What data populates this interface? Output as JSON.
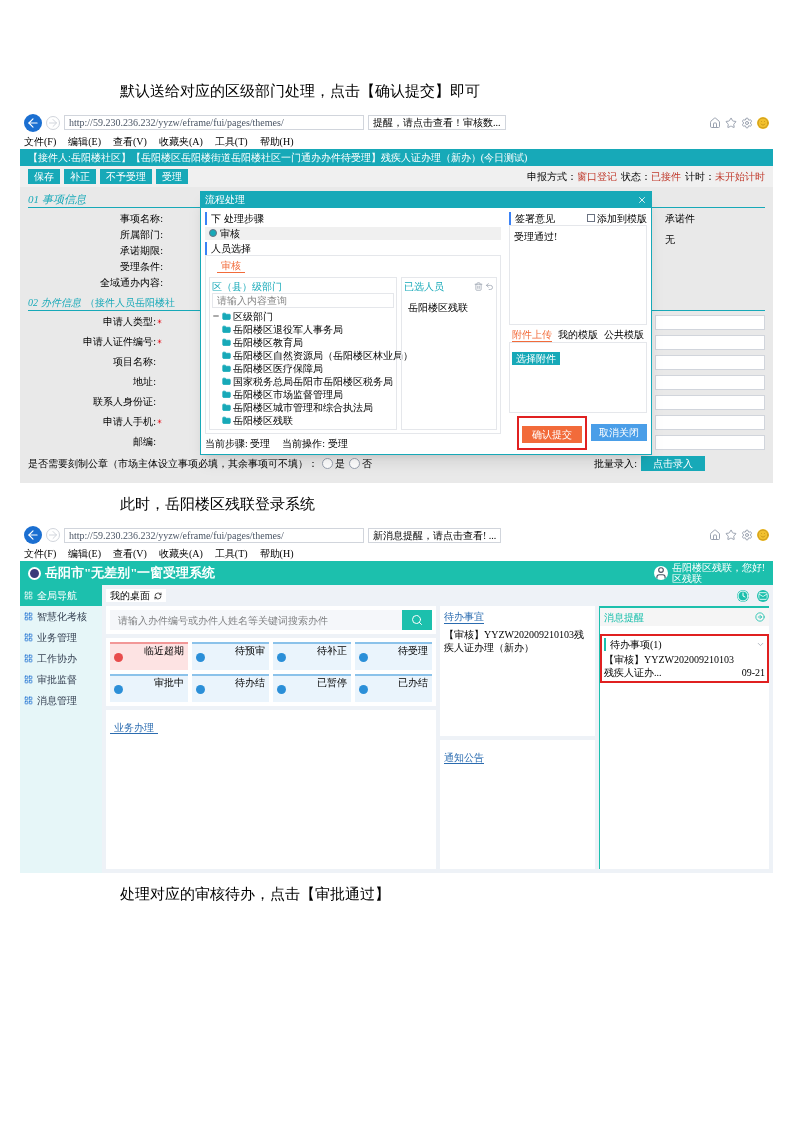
{
  "captions": [
    "默认送给对应的区级部门处理，点击【确认提交】即可",
    "此时，岳阳楼区残联登录系统",
    "处理对应的审核待办，点击【审批通过】"
  ],
  "shot1": {
    "browser": {
      "url": "http://59.230.236.232/yyzw/eframe/fui/pages/themes/",
      "tab": "提醒，请点击查看！审核数...",
      "menu": [
        "文件(F)",
        "编辑(E)",
        "查看(V)",
        "收藏夹(A)",
        "工具(T)",
        "帮助(H)"
      ]
    },
    "header": "【接件人:岳阳楼社区】【岳阳楼区岳阳楼街道岳阳楼社区一门通办办件待受理】残疾人证办理（新办）(今日测试)",
    "toolbar": [
      "保存",
      "补正",
      "不予受理",
      "受理"
    ],
    "status": [
      {
        "label": "申报方式：",
        "value": "窗口登记"
      },
      {
        "label": "状态：",
        "value": "已接件"
      },
      {
        "label": "计时：",
        "value": "未开始计时"
      }
    ],
    "section1": {
      "title": "01 事项信息",
      "fields": [
        "事项名称:",
        "所属部门:",
        "承诺期限:",
        "受理条件:",
        "全域通办内容:"
      ],
      "right_values": [
        "承诺件",
        "无"
      ]
    },
    "section2": {
      "title": "02 办件信息",
      "subtitle": "（接件人员岳阳楼社",
      "fields": [
        {
          "label": "申请人类型:",
          "required": true
        },
        {
          "label": "申请人证件编号:",
          "required": true
        },
        {
          "label": "项目名称:",
          "required": false
        },
        {
          "label": "地址:",
          "required": false
        },
        {
          "label": "联系人身份证:",
          "required": false
        },
        {
          "label": "申请人手机:",
          "required": true
        },
        {
          "label": "邮编:",
          "required": false
        }
      ],
      "seal_question": "是否需要刻制公章（市场主体设立事项必填，其余事项可不填）：",
      "seal_options": [
        {
          "label": "是",
          "selected": false
        },
        {
          "label": "否",
          "selected": false
        }
      ],
      "batch_label": "批量录入:",
      "batch_button": "点击录入"
    },
    "dialog": {
      "title": "流程处理",
      "step_title": "下 处理步骤",
      "step_option": {
        "label": "审核",
        "selected": true
      },
      "person_title": "人员选择",
      "tab": "审核",
      "dept_tab": "区（县）级部门",
      "search_placeholder": "请输入内容查询",
      "tree": {
        "label": "区级部门",
        "expanded": true,
        "children": [
          {
            "label": "岳阳楼区退役军人事务局"
          },
          {
            "label": "岳阳楼区教育局"
          },
          {
            "label": "岳阳楼区自然资源局（岳阳楼区林业局）"
          },
          {
            "label": "岳阳楼区医疗保障局"
          },
          {
            "label": "国家税务总局岳阳市岳阳楼区税务局"
          },
          {
            "label": "岳阳楼区市场监督管理局"
          },
          {
            "label": "岳阳楼区城市管理和综合执法局"
          },
          {
            "label": "岳阳楼区残联"
          }
        ]
      },
      "selected_title": "已选人员",
      "selected_person": "岳阳楼区残联",
      "footer": [
        {
          "label": "当前步骤:",
          "value": "受理"
        },
        {
          "label": "当前操作:",
          "value": "受理"
        }
      ],
      "opinion_title": "签署意见",
      "template_check": {
        "label": "添加到模版",
        "checked": false
      },
      "opinion_text": "受理通过!",
      "tabs": [
        {
          "label": "附件上传",
          "selected": true
        },
        {
          "label": "我的模版",
          "selected": false
        },
        {
          "label": "公共模版",
          "selected": false
        }
      ],
      "upload_button": "选择附件",
      "confirm_button": "确认提交",
      "cancel_button": "取消关闭"
    }
  },
  "shot2": {
    "browser": {
      "url": "http://59.230.236.232/yyzw/eframe/fui/pages/themes/",
      "tab": "新消息提醒，请点击查看! ...",
      "menu": [
        "文件(F)",
        "编辑(E)",
        "查看(V)",
        "收藏夹(A)",
        "工具(T)",
        "帮助(H)"
      ]
    },
    "title": "岳阳市\"无差别\"一窗受理系统",
    "user": "岳阳楼区残联，您好!",
    "user_sub": "区残联",
    "sidebar": [
      {
        "label": "全局导航",
        "selected": true
      },
      {
        "label": "智慧化考核",
        "selected": false
      },
      {
        "label": "业务管理",
        "selected": false
      },
      {
        "label": "工作协办",
        "selected": false
      },
      {
        "label": "审批监督",
        "selected": false
      },
      {
        "label": "消息管理",
        "selected": false
      }
    ],
    "tab": "我的桌面",
    "search_placeholder": "请输入办件编号或办件人姓名等关键词搜索办件",
    "tiles": [
      {
        "label": "临近超期",
        "color": "#e84c4c"
      },
      {
        "label": "待预审",
        "color": "#2b8fd8"
      },
      {
        "label": "待补正",
        "color": "#2b8fd8"
      },
      {
        "label": "待受理",
        "color": "#2b8fd8"
      },
      {
        "label": "审批中",
        "color": "#2b8fd8"
      },
      {
        "label": "待办结",
        "color": "#2b8fd8"
      },
      {
        "label": "已暂停",
        "color": "#2b8fd8"
      },
      {
        "label": "已办结",
        "color": "#2b8fd8"
      }
    ],
    "business_title": "业务办理",
    "todo_title": "待办事宜",
    "todo_items": [
      "【审核】YYZW202009210103残疾人证办理（新办）"
    ],
    "notice_title": "通知公告",
    "messages": {
      "title": "消息提醒",
      "group": "待办事项(1)",
      "items": [
        {
          "text": "【审核】YYZW202009210103残疾人证办...",
          "date": "09-21"
        }
      ]
    }
  }
}
